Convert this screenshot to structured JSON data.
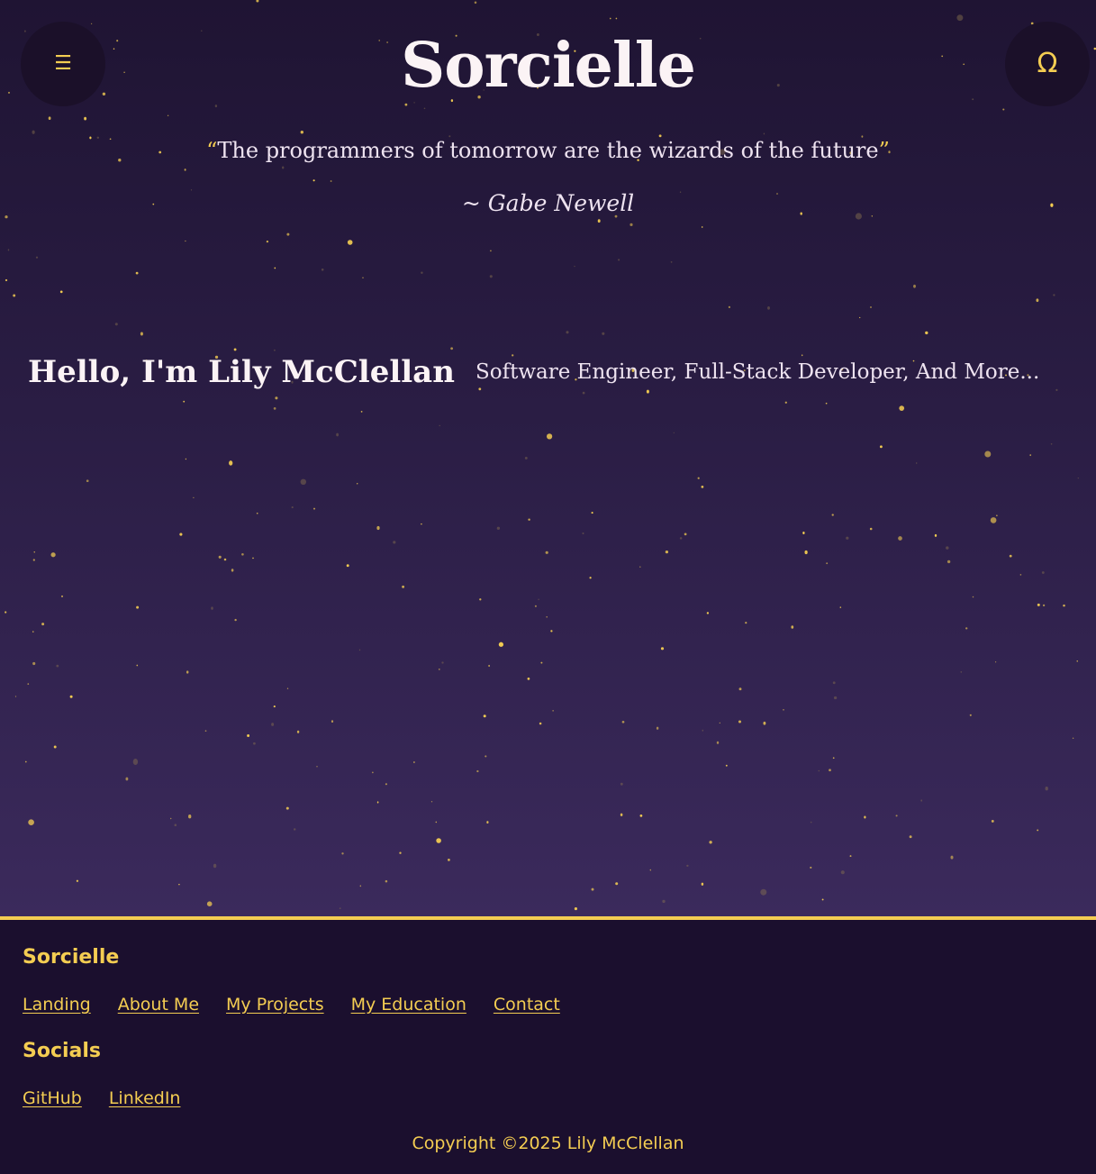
{
  "header": {
    "menu_icon": "☰",
    "menu_icon_name": "hamburger-menu-icon",
    "omega_icon": "Ω",
    "omega_icon_name": "omega-icon",
    "title": "Sorcielle"
  },
  "quote": {
    "open_mark": "“",
    "text": "The programmers of tomorrow are the wizards of the future",
    "close_mark": "”",
    "author": "~ Gabe Newell"
  },
  "intro": {
    "greeting": "Hello, I'm Lily McClellan",
    "tagline": "Software Engineer, Full-Stack Developer, And More..."
  },
  "footer": {
    "brand": "Sorcielle",
    "nav_links": [
      {
        "label": "Landing"
      },
      {
        "label": "About Me"
      },
      {
        "label": "My Projects"
      },
      {
        "label": "My Education"
      },
      {
        "label": "Contact"
      }
    ],
    "socials_heading": "Socials",
    "social_links": [
      {
        "label": "GitHub"
      },
      {
        "label": "LinkedIn"
      }
    ],
    "copyright": "Copyright ©2025 Lily McClellan"
  },
  "colors": {
    "accent": "#f4cd52",
    "background_top": "#1f1433",
    "background_bottom": "#3b2a5c",
    "footer_background": "#1b0f2e",
    "text_light": "#fbf3f5"
  }
}
